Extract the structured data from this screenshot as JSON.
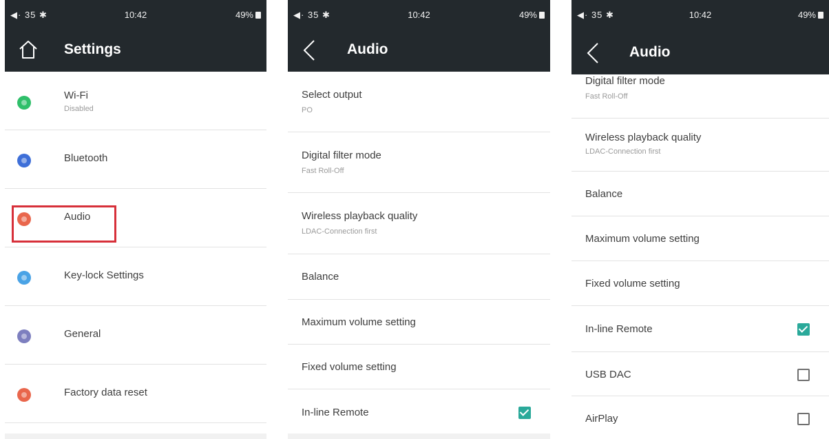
{
  "status_bar": {
    "left": "◀· 35 ✱",
    "time": "10:42",
    "battery": "49%"
  },
  "screens": [
    {
      "title": "Settings",
      "items": [
        {
          "label": "Wi-Fi",
          "sub": "Disabled",
          "color": "#2fbf6a"
        },
        {
          "label": "Bluetooth",
          "sub": "",
          "color": "#3e6fd8"
        },
        {
          "label": "Audio",
          "sub": "",
          "color": "#e9664c"
        },
        {
          "label": "Key-lock Settings",
          "sub": "",
          "color": "#4aa3e6"
        },
        {
          "label": "General",
          "sub": "",
          "color": "#7d7fbf"
        },
        {
          "label": "Factory data reset",
          "sub": "",
          "color": "#e9664c"
        }
      ]
    },
    {
      "title": "Audio",
      "items": [
        {
          "label": "Select output",
          "sub": "PO"
        },
        {
          "label": "Digital filter mode",
          "sub": "Fast Roll-Off"
        },
        {
          "label": "Wireless playback quality",
          "sub": "LDAC-Connection first"
        },
        {
          "label": "Balance",
          "sub": ""
        },
        {
          "label": "Maximum volume setting",
          "sub": ""
        },
        {
          "label": "Fixed volume setting",
          "sub": ""
        },
        {
          "label": "In-line Remote",
          "sub": "",
          "checked": true
        }
      ]
    },
    {
      "title": "Audio",
      "items": [
        {
          "label": "Digital filter mode",
          "sub": "Fast Roll-Off"
        },
        {
          "label": "Wireless playback quality",
          "sub": "LDAC-Connection first"
        },
        {
          "label": "Balance",
          "sub": ""
        },
        {
          "label": "Maximum volume setting",
          "sub": ""
        },
        {
          "label": "Fixed volume setting",
          "sub": ""
        },
        {
          "label": "In-line Remote",
          "sub": "",
          "checked": true
        },
        {
          "label": "USB DAC",
          "sub": "",
          "checked": false
        },
        {
          "label": "AirPlay",
          "sub": "",
          "checked": false
        }
      ]
    }
  ],
  "colors": {
    "bar": "#23292d",
    "highlight": "#d7303a",
    "checkbox_on": "#2aa99a"
  }
}
